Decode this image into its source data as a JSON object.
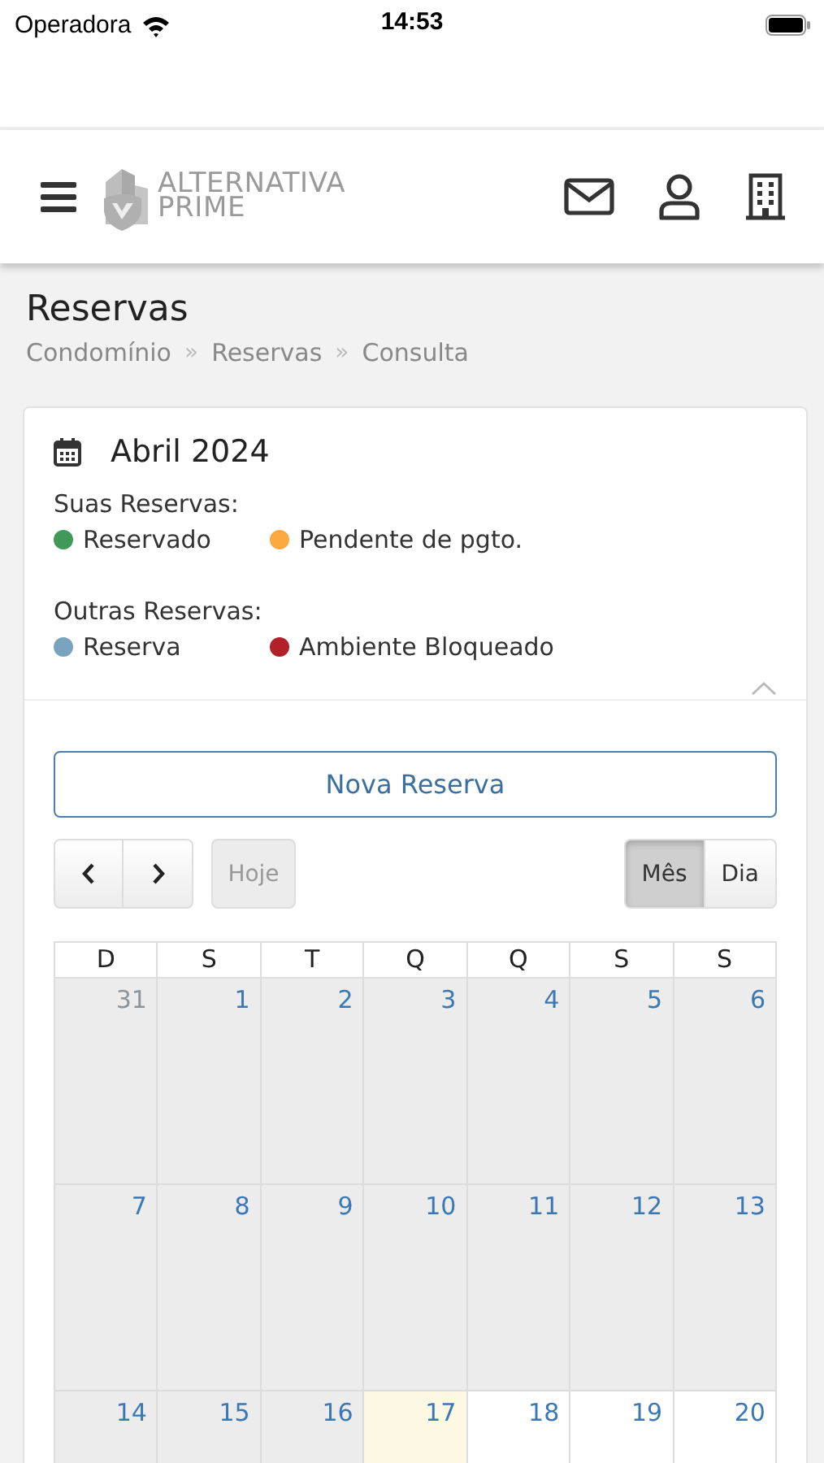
{
  "status_bar": {
    "carrier": "Operadora",
    "time": "14:53"
  },
  "header": {
    "logo": [
      "ALTERNATIVA",
      "PRIME"
    ]
  },
  "page": {
    "title": "Reservas",
    "breadcrumb": [
      "Condomínio",
      "Reservas",
      "Consulta"
    ],
    "separator": "»"
  },
  "card": {
    "month": "Abril 2024",
    "legend": [
      {
        "title": "Suas Reservas:",
        "items": [
          {
            "label": "Reservado",
            "color": "#3f9a5a"
          },
          {
            "label": "Pendente de pgto.",
            "color": "#fbaa42"
          }
        ]
      },
      {
        "title": "Outras Reservas:",
        "items": [
          {
            "label": "Reserva",
            "color": "#79a3bf"
          },
          {
            "label": "Ambiente Bloqueado",
            "color": "#b3202a"
          }
        ]
      }
    ],
    "new_button": "Nova Reserva",
    "today_button": {
      "label": "Hoje",
      "disabled": true
    },
    "views": [
      {
        "label": "Mês",
        "selected": true
      },
      {
        "label": "Dia",
        "selected": false
      }
    ]
  },
  "calendar": {
    "weekdays": [
      "D",
      "S",
      "T",
      "Q",
      "Q",
      "S",
      "S"
    ],
    "weeks": [
      [
        {
          "day": "31",
          "kind": "other"
        },
        {
          "day": "1",
          "kind": "past"
        },
        {
          "day": "2",
          "kind": "past"
        },
        {
          "day": "3",
          "kind": "past"
        },
        {
          "day": "4",
          "kind": "past"
        },
        {
          "day": "5",
          "kind": "past"
        },
        {
          "day": "6",
          "kind": "past"
        }
      ],
      [
        {
          "day": "7",
          "kind": "past"
        },
        {
          "day": "8",
          "kind": "past"
        },
        {
          "day": "9",
          "kind": "past"
        },
        {
          "day": "10",
          "kind": "past"
        },
        {
          "day": "11",
          "kind": "past"
        },
        {
          "day": "12",
          "kind": "past"
        },
        {
          "day": "13",
          "kind": "past"
        }
      ],
      [
        {
          "day": "14",
          "kind": "past"
        },
        {
          "day": "15",
          "kind": "past"
        },
        {
          "day": "16",
          "kind": "past"
        },
        {
          "day": "17",
          "kind": "today"
        },
        {
          "day": "18",
          "kind": "future"
        },
        {
          "day": "19",
          "kind": "future"
        },
        {
          "day": "20",
          "kind": "future"
        }
      ]
    ]
  }
}
